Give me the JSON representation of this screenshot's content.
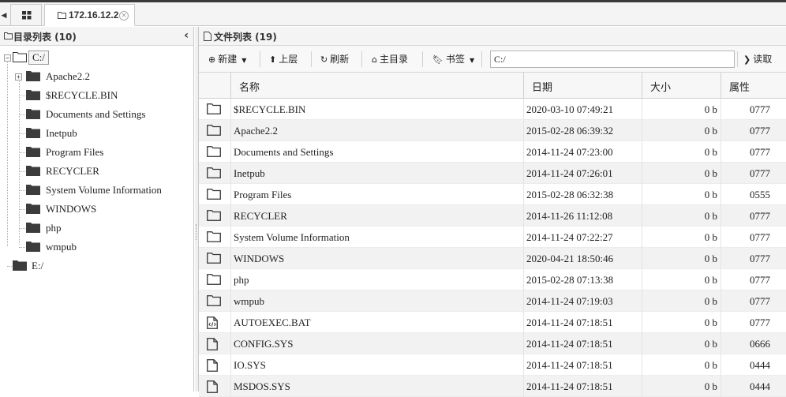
{
  "tabbar": {
    "scroll_left_icon": "caret-left",
    "grid_icon": "grid-icon",
    "host_tab": {
      "label": "172.16.12.2",
      "close_glyph": "×"
    }
  },
  "left_panel": {
    "title": "目录列表 (10)",
    "collapse_glyph": "‹",
    "tree": {
      "root_c": {
        "label": "C:/",
        "expander": "−"
      },
      "children": [
        {
          "label": "Apache2.2",
          "expander": "+"
        },
        {
          "label": "$RECYCLE.BIN"
        },
        {
          "label": "Documents and Settings"
        },
        {
          "label": "Inetpub"
        },
        {
          "label": "Program Files"
        },
        {
          "label": "RECYCLER"
        },
        {
          "label": "System Volume Information"
        },
        {
          "label": "WINDOWS"
        },
        {
          "label": "php"
        },
        {
          "label": "wmpub"
        }
      ],
      "root_e": {
        "label": "E:/"
      }
    }
  },
  "right_panel": {
    "title": "文件列表 (19)",
    "toolbar": {
      "new_label": "新建",
      "up_label": "上层",
      "refresh_label": "刷新",
      "home_label": "主目录",
      "bookmark_label": "书签",
      "path_value": "C:/",
      "read_label": "读取"
    },
    "columns": {
      "name": "名称",
      "date": "日期",
      "size": "大小",
      "attr": "属性"
    },
    "rows": [
      {
        "type": "folder",
        "name": "$RECYCLE.BIN",
        "date": "2020-03-10 07:49:21",
        "size": "0 b",
        "attr": "0777"
      },
      {
        "type": "folder",
        "name": "Apache2.2",
        "date": "2015-02-28 06:39:32",
        "size": "0 b",
        "attr": "0777"
      },
      {
        "type": "folder",
        "name": "Documents and Settings",
        "date": "2014-11-24 07:23:00",
        "size": "0 b",
        "attr": "0777"
      },
      {
        "type": "folder",
        "name": "Inetpub",
        "date": "2014-11-24 07:26:01",
        "size": "0 b",
        "attr": "0777"
      },
      {
        "type": "folder",
        "name": "Program Files",
        "date": "2015-02-28 06:32:38",
        "size": "0 b",
        "attr": "0555"
      },
      {
        "type": "folder",
        "name": "RECYCLER",
        "date": "2014-11-26 11:12:08",
        "size": "0 b",
        "attr": "0777"
      },
      {
        "type": "folder",
        "name": "System Volume Information",
        "date": "2014-11-24 07:22:27",
        "size": "0 b",
        "attr": "0777"
      },
      {
        "type": "folder",
        "name": "WINDOWS",
        "date": "2020-04-21 18:50:46",
        "size": "0 b",
        "attr": "0777"
      },
      {
        "type": "folder",
        "name": "php",
        "date": "2015-02-28 07:13:38",
        "size": "0 b",
        "attr": "0777"
      },
      {
        "type": "folder",
        "name": "wmpub",
        "date": "2014-11-24 07:19:03",
        "size": "0 b",
        "attr": "0777"
      },
      {
        "type": "code-file",
        "name": "AUTOEXEC.BAT",
        "date": "2014-11-24 07:18:51",
        "size": "0 b",
        "attr": "0777"
      },
      {
        "type": "file",
        "name": "CONFIG.SYS",
        "date": "2014-11-24 07:18:51",
        "size": "0 b",
        "attr": "0666"
      },
      {
        "type": "file",
        "name": "IO.SYS",
        "date": "2014-11-24 07:18:51",
        "size": "0 b",
        "attr": "0444"
      },
      {
        "type": "file",
        "name": "MSDOS.SYS",
        "date": "2014-11-24 07:18:51",
        "size": "0 b",
        "attr": "0444"
      }
    ]
  }
}
